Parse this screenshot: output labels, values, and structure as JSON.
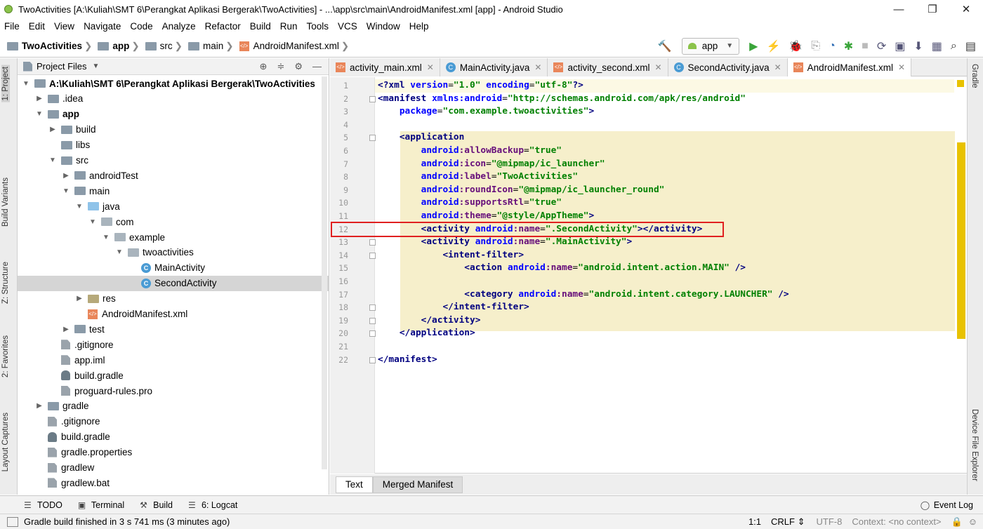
{
  "window": {
    "title": "TwoActivities [A:\\Kuliah\\SMT 6\\Perangkat Aplikasi Bergerak\\TwoActivities] - ...\\app\\src\\main\\AndroidManifest.xml [app] - Android Studio",
    "minimize": "—",
    "maximize": "❐",
    "close": "✕"
  },
  "menu": [
    "File",
    "Edit",
    "View",
    "Navigate",
    "Code",
    "Analyze",
    "Refactor",
    "Build",
    "Run",
    "Tools",
    "VCS",
    "Window",
    "Help"
  ],
  "breadcrumb": [
    "TwoActivities",
    "app",
    "src",
    "main",
    "AndroidManifest.xml"
  ],
  "run_config": "app",
  "left_tool_tabs": [
    "1: Project",
    "Build Variants",
    "Z: Structure",
    "2: Favorites",
    "Layout Captures"
  ],
  "right_tool_tabs": [
    "Gradle",
    "Device File Explorer"
  ],
  "project_panel": {
    "title": "Project Files",
    "tree": [
      {
        "label": "A:\\Kuliah\\SMT 6\\Perangkat Aplikasi Bergerak\\TwoActivities",
        "bold": true
      },
      {
        "label": ".idea"
      },
      {
        "label": "app",
        "bold": true
      },
      {
        "label": "build"
      },
      {
        "label": "libs"
      },
      {
        "label": "src"
      },
      {
        "label": "androidTest"
      },
      {
        "label": "main"
      },
      {
        "label": "java"
      },
      {
        "label": "com"
      },
      {
        "label": "example"
      },
      {
        "label": "twoactivities"
      },
      {
        "label": "MainActivity"
      },
      {
        "label": "SecondActivity",
        "selected": true
      },
      {
        "label": "res"
      },
      {
        "label": "AndroidManifest.xml"
      },
      {
        "label": "test"
      },
      {
        "label": ".gitignore"
      },
      {
        "label": "app.iml"
      },
      {
        "label": "build.gradle"
      },
      {
        "label": "proguard-rules.pro"
      },
      {
        "label": "gradle"
      },
      {
        "label": ".gitignore"
      },
      {
        "label": "build.gradle"
      },
      {
        "label": "gradle.properties"
      },
      {
        "label": "gradlew"
      },
      {
        "label": "gradlew.bat"
      }
    ]
  },
  "editor_tabs": [
    {
      "label": "activity_main.xml",
      "active": false
    },
    {
      "label": "MainActivity.java",
      "active": false
    },
    {
      "label": "activity_second.xml",
      "active": false
    },
    {
      "label": "SecondActivity.java",
      "active": false
    },
    {
      "label": "AndroidManifest.xml",
      "active": true
    }
  ],
  "code_lines": [
    "<?xml version=\"1.0\" encoding=\"utf-8\"?>",
    "<manifest xmlns:android=\"http://schemas.android.com/apk/res/android\"",
    "    package=\"com.example.twoactivities\">",
    "",
    "    <application",
    "        android:allowBackup=\"true\"",
    "        android:icon=\"@mipmap/ic_launcher\"",
    "        android:label=\"TwoActivities\"",
    "        android:roundIcon=\"@mipmap/ic_launcher_round\"",
    "        android:supportsRtl=\"true\"",
    "        android:theme=\"@style/AppTheme\">",
    "        <activity android:name=\".SecondActivity\"></activity>",
    "        <activity android:name=\".MainActivity\">",
    "            <intent-filter>",
    "                <action android:name=\"android.intent.action.MAIN\" />",
    "",
    "                <category android:name=\"android.intent.category.LAUNCHER\" />",
    "            </intent-filter>",
    "        </activity>",
    "    </application>",
    "",
    "</manifest>"
  ],
  "highlighted_line": 12,
  "bottom_editor_tabs": [
    "Text",
    "Merged Manifest"
  ],
  "tool_windows": [
    "TODO",
    "Terminal",
    "Build",
    "6: Logcat"
  ],
  "event_log": "Event Log",
  "status": {
    "message": "Gradle build finished in 3 s 741 ms (3 minutes ago)",
    "position": "1:1",
    "line_sep": "CRLF ⇕",
    "encoding": "UTF-8",
    "context": "Context: <no context>"
  },
  "colors": {
    "highlight": "#f6efcb",
    "annotation_box": "#e02020",
    "scroll_marker": "#e8c200"
  }
}
